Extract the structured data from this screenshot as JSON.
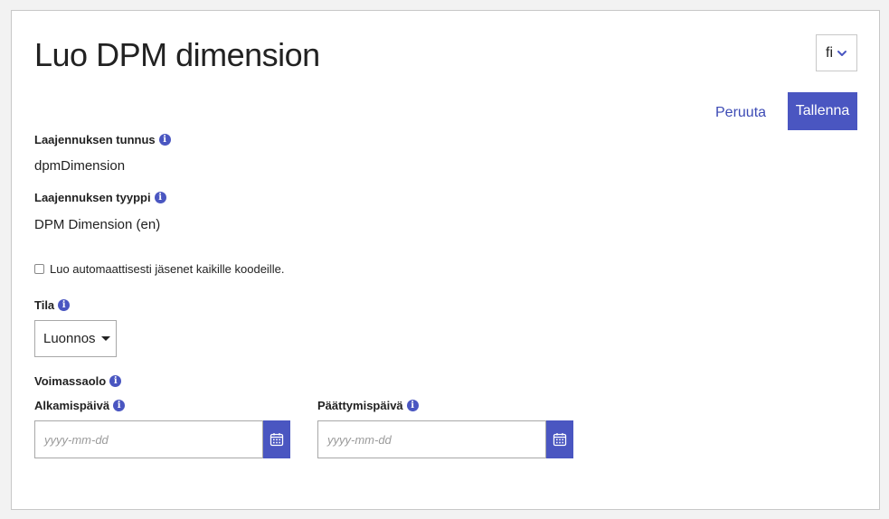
{
  "page": {
    "title": "Luo DPM dimension",
    "language": "fi"
  },
  "actions": {
    "cancel_label": "Peruuta",
    "save_label": "Tallenna"
  },
  "fields": {
    "extension_id": {
      "label": "Laajennuksen tunnus",
      "value": "dpmDimension"
    },
    "extension_type": {
      "label": "Laajennuksen tyyppi",
      "value": "DPM Dimension (en)"
    },
    "auto_members": {
      "label": "Luo automaattisesti jäsenet kaikille koodeille.",
      "checked": false
    },
    "status": {
      "label": "Tila",
      "value": "Luonnos"
    },
    "validity": {
      "label": "Voimassaolo"
    },
    "start_date": {
      "label": "Alkamispäivä",
      "placeholder": "yyyy-mm-dd"
    },
    "end_date": {
      "label": "Päättymispäivä",
      "placeholder": "yyyy-mm-dd"
    }
  },
  "icons": {
    "info": "info-icon",
    "calendar": "calendar-icon",
    "chevron": "chevron-down-icon"
  },
  "colors": {
    "accent": "#4a56c1",
    "link": "#3d4bb5"
  }
}
